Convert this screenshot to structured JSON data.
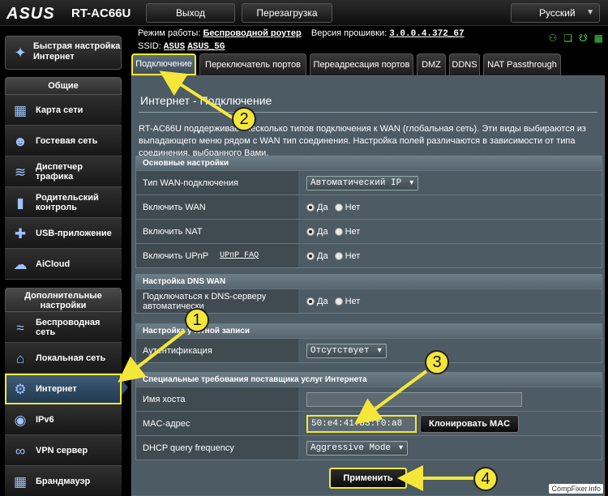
{
  "header": {
    "brand": "ASUS",
    "model": "RT-AC66U",
    "logout_label": "Выход",
    "reboot_label": "Перезагрузка",
    "language": "Русский"
  },
  "info": {
    "mode_label": "Режим работы:",
    "mode_value": "Беспроводной роутер",
    "firmware_label": "Версия прошивки:",
    "firmware_value": "3.0.0.4.372_67",
    "ssid_label": "SSID:",
    "ssid_1": "ASUS",
    "ssid_2": "ASUS_5G"
  },
  "sidebar": {
    "quick_setup": "Быстрая настройка Интернет",
    "general_header": "Общие",
    "general_items": [
      {
        "label": "Карта сети",
        "icon": "network-map-icon"
      },
      {
        "label": "Гостевая сеть",
        "icon": "guest-network-icon"
      },
      {
        "label": "Диспетчер трафика",
        "icon": "traffic-manager-icon"
      },
      {
        "label": "Родительский контроль",
        "icon": "parental-control-icon"
      },
      {
        "label": "USB-приложение",
        "icon": "usb-app-icon"
      },
      {
        "label": "AiCloud",
        "icon": "aicloud-icon"
      }
    ],
    "advanced_header": "Дополнительные настройки",
    "advanced_items": [
      {
        "label": "Беспроводная сеть",
        "icon": "wireless-icon"
      },
      {
        "label": "Локальная сеть",
        "icon": "lan-icon"
      },
      {
        "label": "Интернет",
        "icon": "globe-icon"
      },
      {
        "label": "IPv6",
        "icon": "ipv6-icon"
      },
      {
        "label": "VPN сервер",
        "icon": "vpn-icon"
      },
      {
        "label": "Брандмауэр",
        "icon": "firewall-icon"
      }
    ]
  },
  "tabs": [
    "Подключение",
    "Переключатель портов",
    "Переадресация портов",
    "DMZ",
    "DDNS",
    "NAT Passthrough"
  ],
  "panel": {
    "title": "Интернет - Подключение",
    "description": "RT-AC66U поддерживает несколько типов подключения к WAN (глобальная сеть). Эти виды выбираются из выпадающего меню рядом с WAN тип соединения. Настройка полей различаются в зависимости от типа соединения, выбранного Вами.",
    "basic": {
      "header": "Основные настройки",
      "wan_type_label": "Тип WAN-подключения",
      "wan_type_value": "Автоматический IP",
      "enable_wan_label": "Включить WAN",
      "enable_nat_label": "Включить NAT",
      "enable_upnp_label": "Включить UPnP",
      "upnp_faq": "UPnP FAQ"
    },
    "dns": {
      "header": "Настройка DNS WAN",
      "auto_dns_label": "Подключаться к DNS-серверу автоматически"
    },
    "account": {
      "header": "Настройка учетной записи",
      "auth_label": "Аутентификация",
      "auth_value": "Отсутствует"
    },
    "isp": {
      "header": "Специальные требования поставщика услуг Интернета",
      "hostname_label": "Имя хоста",
      "hostname_value": "",
      "mac_label": "MAC-адрес",
      "mac_value": "50:e4:41:b3:f0:a8",
      "clone_mac_label": "Клонировать MAC",
      "dhcp_freq_label": "DHCP query frequency",
      "dhcp_freq_value": "Aggressive Mode"
    },
    "yes_label": "Да",
    "no_label": "Нет",
    "apply_label": "Применить"
  },
  "annotations": [
    "1",
    "2",
    "3",
    "4"
  ],
  "watermark": "CompFixer.info"
}
